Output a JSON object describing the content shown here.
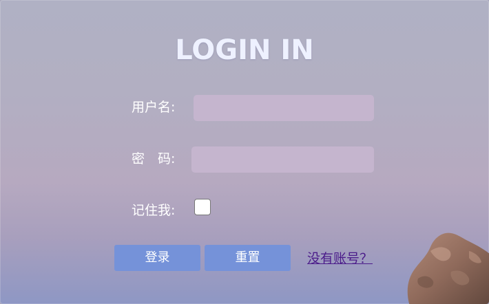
{
  "form": {
    "title": "LOGIN IN",
    "username_label": "用户名:",
    "username_value": "",
    "password_label": "密　码:",
    "password_value": "",
    "remember_label": "记住我:",
    "remember_checked": false,
    "login_button": "登录",
    "reset_button": "重置",
    "register_link": "没有账号？"
  },
  "colors": {
    "button": "#7592d9",
    "input": "#c5b5ce",
    "link": "#4b1c8a",
    "title": "#eef1ff"
  }
}
